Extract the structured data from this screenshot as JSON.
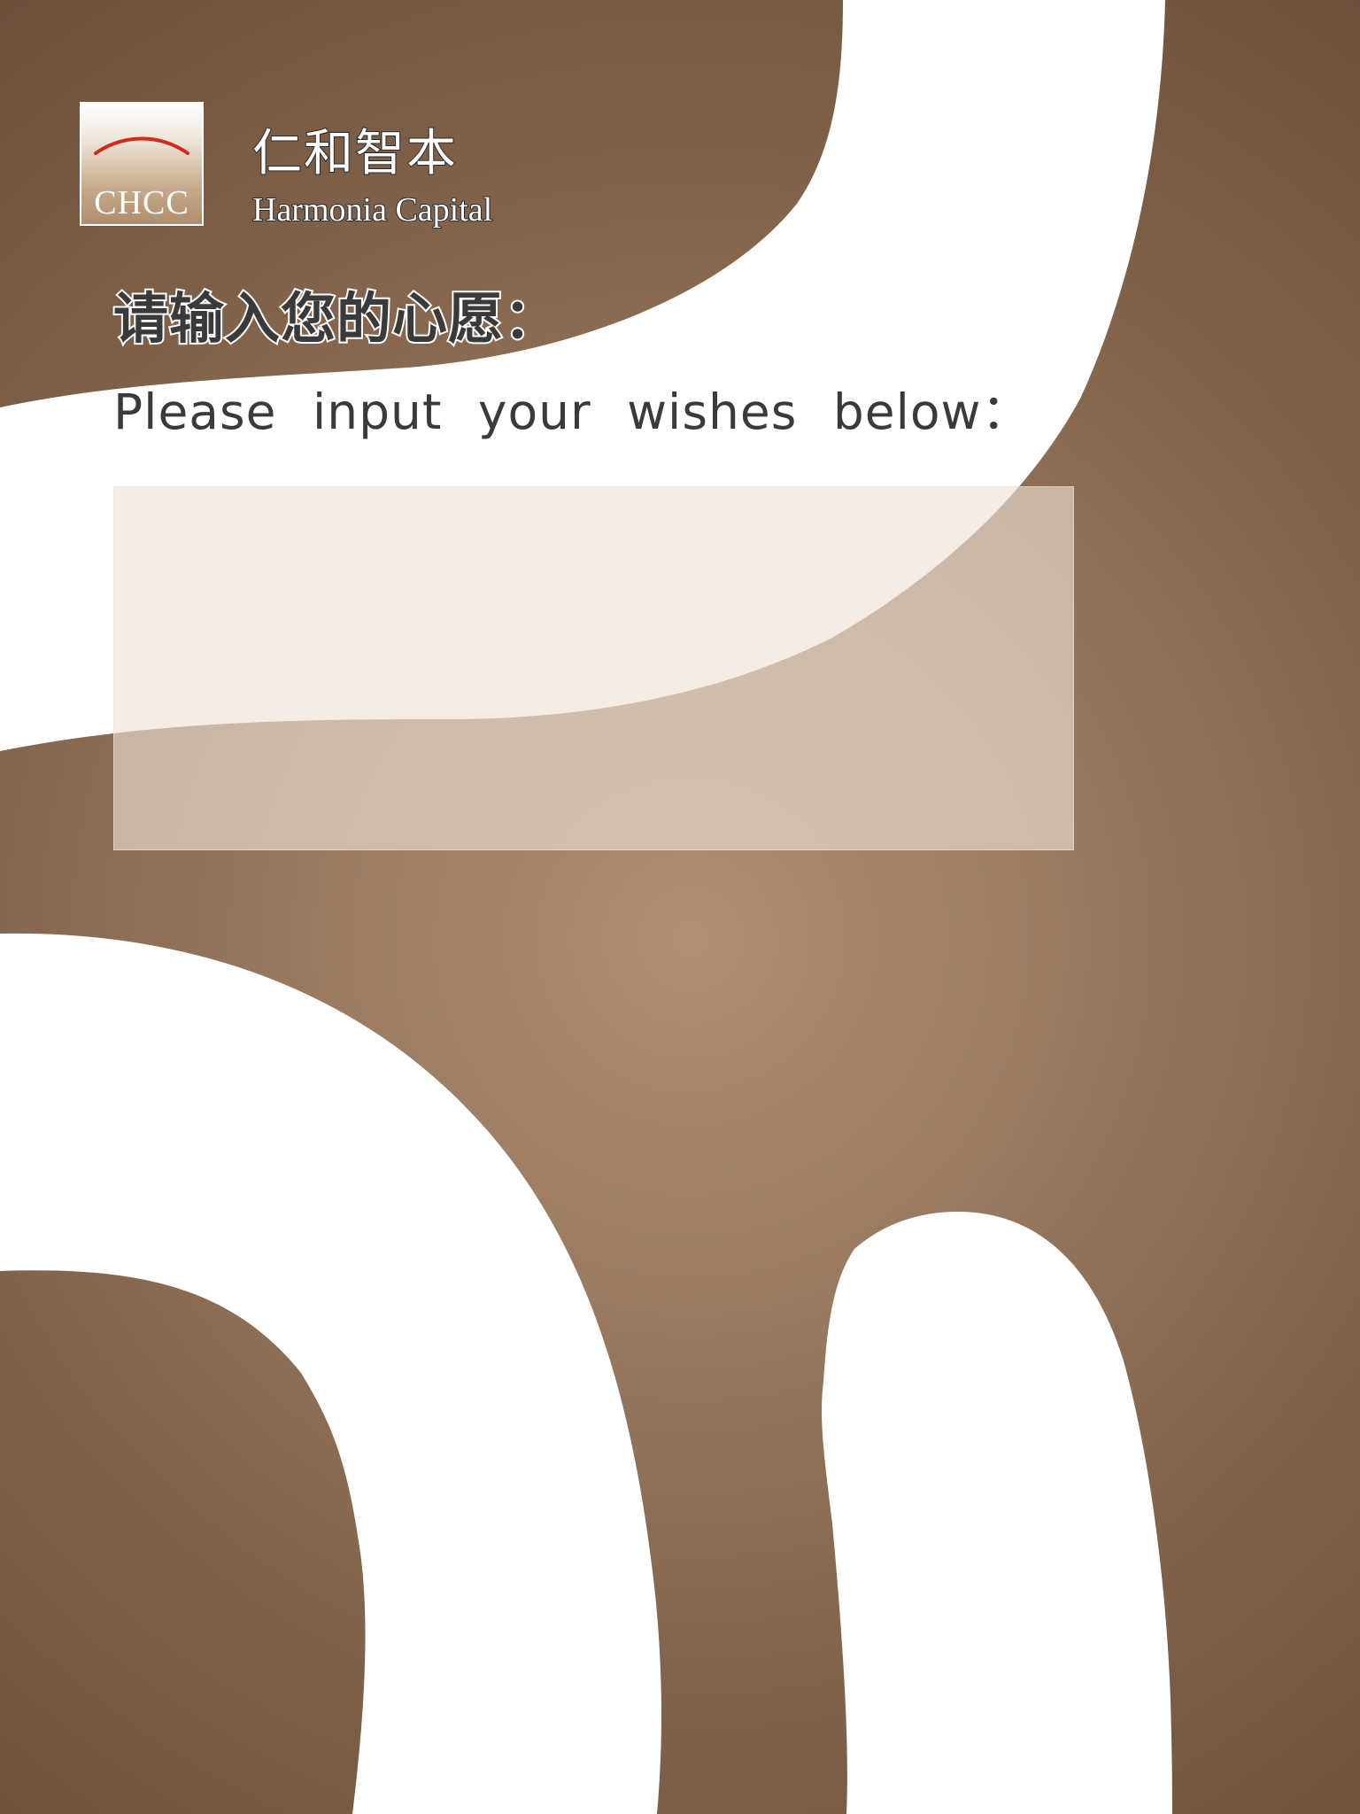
{
  "colors": {
    "background_center": "#b08f72",
    "background_edge": "#6a4d38",
    "ribbon": "#ffffff",
    "logo_arc": "#d42a1e",
    "text_dark": "#3a3a3a"
  },
  "logo": {
    "mark_text": "CHCC"
  },
  "brand": {
    "chinese_name": "仁和智本",
    "english_name": "Harmonia Capital"
  },
  "prompt": {
    "chinese": "请输入您的心愿：",
    "english": "Please input your wishes below："
  },
  "wish_input": {
    "value": "",
    "placeholder": ""
  }
}
